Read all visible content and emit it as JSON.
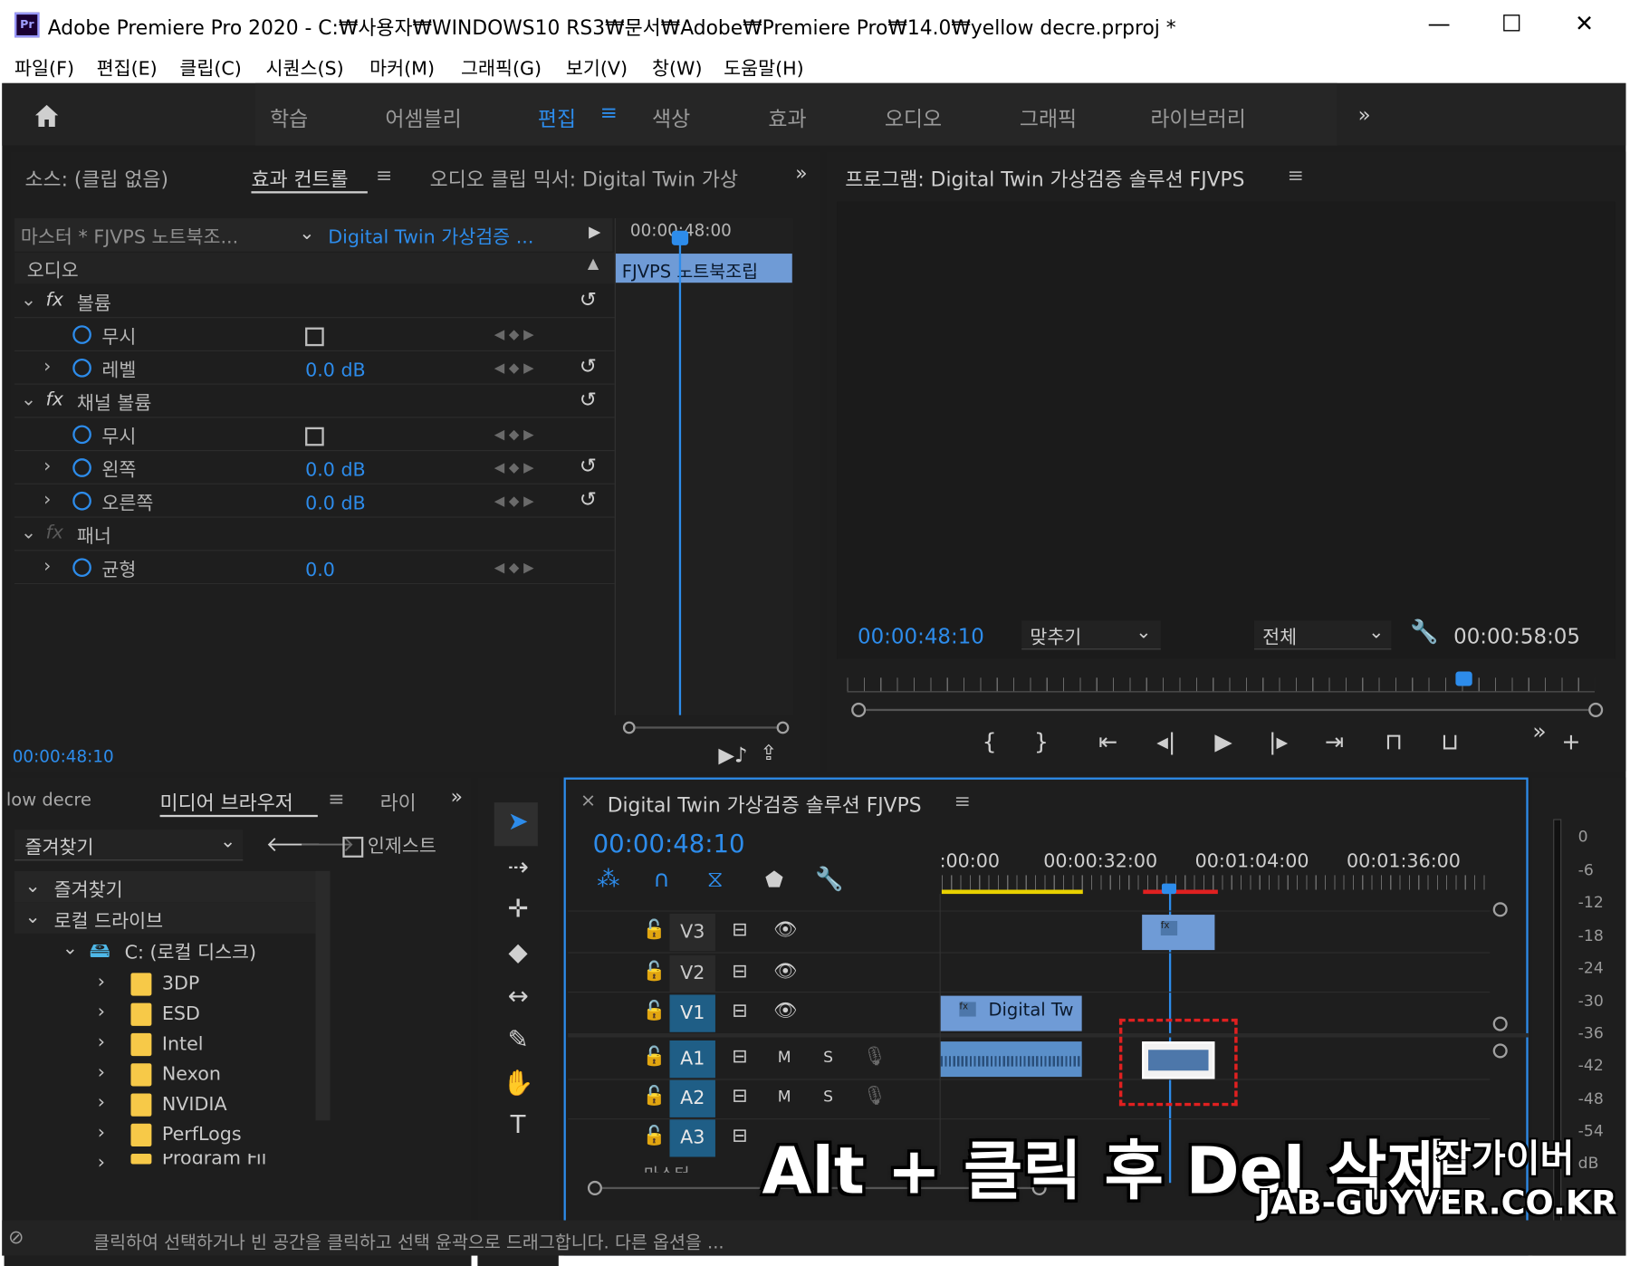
{
  "window": {
    "title": "Adobe Premiere Pro 2020 - C:₩사용자₩WINDOWS10 RS3₩문서₩Adobe₩Premiere Pro₩14.0₩yellow decre.prproj *",
    "app_icon": "Pr",
    "minimize": "—",
    "maximize": "☐",
    "close": "✕"
  },
  "menu": [
    "파일(F)",
    "편집(E)",
    "클립(C)",
    "시퀀스(S)",
    "마커(M)",
    "그래픽(G)",
    "보기(V)",
    "창(W)",
    "도움말(H)"
  ],
  "workspaces": {
    "items": [
      "학습",
      "어셈블리",
      "편집",
      "색상",
      "효과",
      "오디오",
      "그래픽",
      "라이브러리"
    ],
    "active": "편집",
    "more": "»"
  },
  "source_panel": {
    "tabs": [
      "소스: (클립 없음)",
      "효과 컨트롤",
      "오디오 클립 믹서: Digital Twin 가상"
    ],
    "active_tab": "효과 컨트롤",
    "menu_icon": "≡",
    "more": "»",
    "master_label": "마스터 * FJVPS 노트북조...",
    "sequence_label": "Digital Twin 가상검증 ...",
    "timecode_ruler": "00:00:48:00",
    "clip_label": "FJVPS 노트북조립",
    "section": "오디오",
    "effects": [
      {
        "name": "볼륨",
        "fx": "fx"
      },
      {
        "name": "무시"
      },
      {
        "name": "레벨",
        "value": "0.0 dB"
      },
      {
        "name": "채널 볼륨",
        "fx": "fx"
      },
      {
        "name": "무시"
      },
      {
        "name": "왼쪽",
        "value": "0.0 dB"
      },
      {
        "name": "오른쪽",
        "value": "0.0 dB"
      },
      {
        "name": "패너",
        "fx": "fx"
      },
      {
        "name": "균형",
        "value": "0.0"
      }
    ],
    "timecode": "00:00:48:10"
  },
  "program_panel": {
    "title": "프로그램: Digital Twin 가상검증 솔루션 FJVPS",
    "menu_icon": "≡",
    "timecode": "00:00:48:10",
    "fit": "맞추기",
    "resolution": "전체",
    "duration": "00:00:58:05",
    "more": "»",
    "add": "+"
  },
  "project_panel": {
    "tab_partial": "low decre",
    "tab_media": "미디어 브라우저",
    "tab_lib": "라이",
    "more": "»",
    "favorites_select": "즐겨찾기",
    "ingest": "인제스트",
    "tree": [
      {
        "label": "즐겨찾기",
        "level": 0
      },
      {
        "label": "로컬 드라이브",
        "level": 0
      },
      {
        "label": "C: (로컬 디스크)",
        "level": 1
      },
      {
        "label": "3DP",
        "level": 2
      },
      {
        "label": "ESD",
        "level": 2
      },
      {
        "label": "Intel",
        "level": 2
      },
      {
        "label": "Nexon",
        "level": 2
      },
      {
        "label": "NVIDIA",
        "level": 2
      },
      {
        "label": "PerfLogs",
        "level": 2
      },
      {
        "label": "Program Fil",
        "level": 2
      }
    ]
  },
  "timeline": {
    "sequence_name": "Digital Twin 가상검증 솔루션 FJVPS",
    "menu_icon": "≡",
    "close": "×",
    "timecode": "00:00:48:10",
    "ruler": [
      ":00:00",
      "00:00:32:00",
      "00:01:04:00",
      "00:01:36:00"
    ],
    "video_tracks": [
      "V3",
      "V2",
      "V1"
    ],
    "audio_tracks": [
      "A1",
      "A2",
      "A3"
    ],
    "mute": "M",
    "solo": "S",
    "clip_v1_label": "Digital Tw",
    "master_partial": "마스터"
  },
  "meter_scale": [
    "0",
    "-6",
    "-12",
    "-18",
    "-24",
    "-30",
    "-36",
    "-42",
    "-48",
    "-54",
    "dB"
  ],
  "status_bar": "클릭하여 선택하거나 빈 공간을 클릭하고 선택 윤곽으로 드래그합니다. 다른 옵션을 ...",
  "overlay": {
    "caption": "Alt + 클릭 후 Del 삭제",
    "brand": "잡가이버",
    "site": "JAB-GUYVER.CO.KR"
  },
  "colors": {
    "accent": "#2d8ceb",
    "panel_bg": "#1e1e1e",
    "clip_video": "#6f9bd6",
    "clip_audio": "#5a8fc9",
    "track_on": "#1f5e86",
    "selection_dashed": "#e02020"
  }
}
